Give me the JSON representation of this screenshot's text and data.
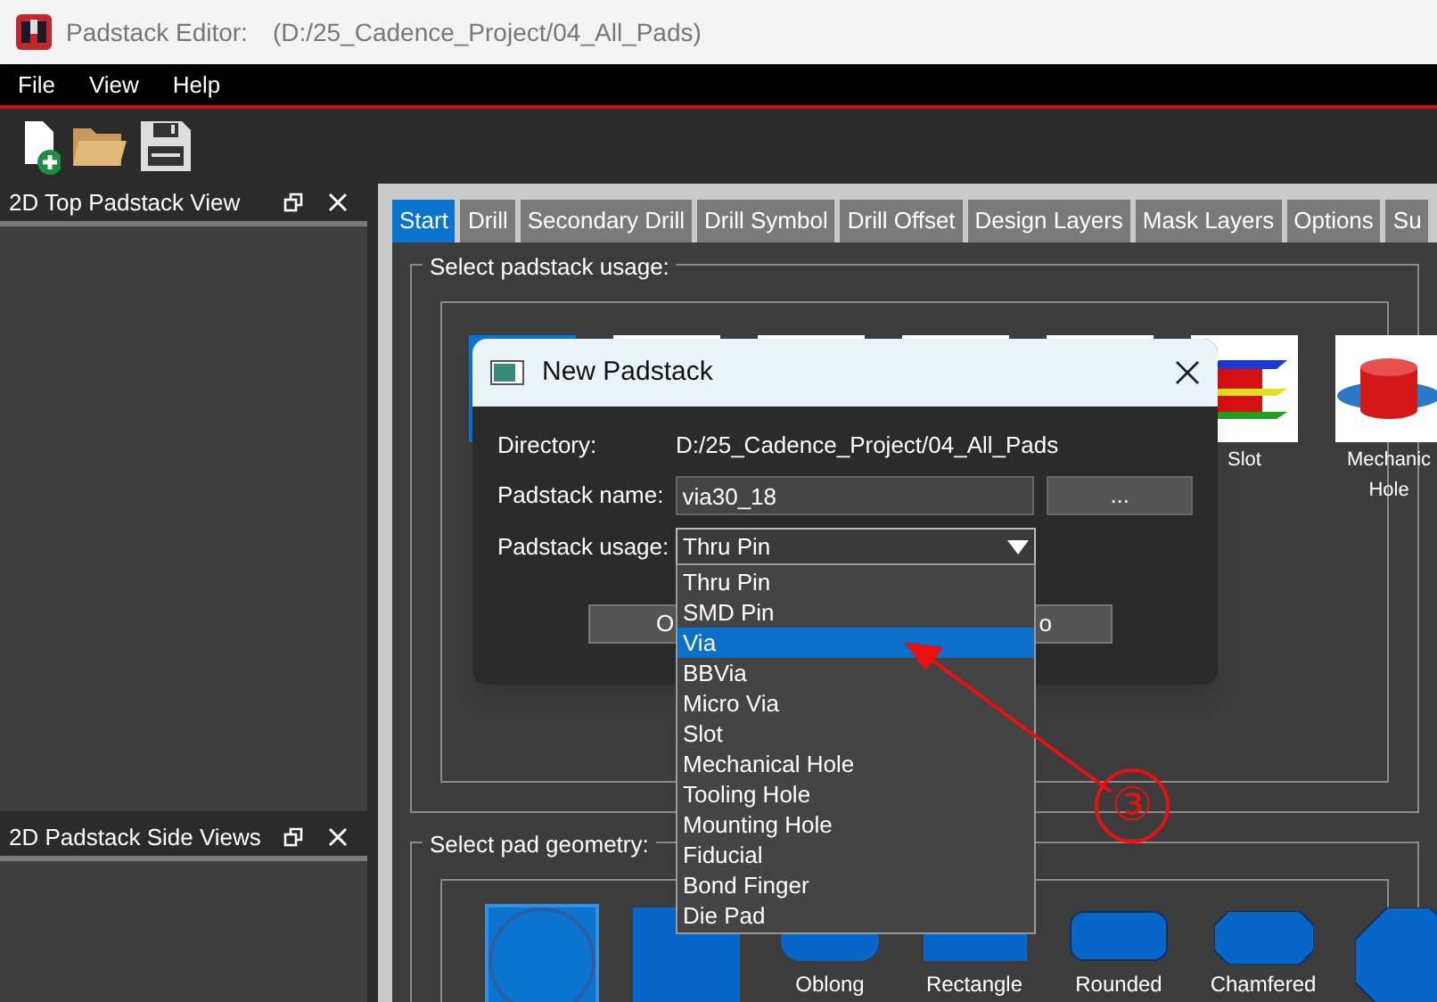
{
  "window": {
    "title": "Padstack Editor:",
    "path": "(D:/25_Cadence_Project/04_All_Pads)"
  },
  "menu": [
    "File",
    "View",
    "Help"
  ],
  "panels": [
    {
      "title": "2D Top Padstack View"
    },
    {
      "title": "2D Padstack Side Views"
    }
  ],
  "tabs": [
    {
      "label": "Start",
      "selected": true
    },
    {
      "label": "Drill",
      "selected": false
    },
    {
      "label": "Secondary Drill",
      "selected": false
    },
    {
      "label": "Drill Symbol",
      "selected": false
    },
    {
      "label": "Drill Offset",
      "selected": false
    },
    {
      "label": "Design Layers",
      "selected": false
    },
    {
      "label": "Mask Layers",
      "selected": false
    },
    {
      "label": "Options",
      "selected": false
    },
    {
      "label": "Su",
      "selected": false
    }
  ],
  "usage_group": {
    "title": "Select padstack usage:",
    "items": [
      {
        "kind": "blank",
        "selected": true
      },
      {
        "kind": "blank",
        "selected": false
      },
      {
        "kind": "blank",
        "selected": false
      },
      {
        "kind": "blank",
        "selected": false
      },
      {
        "kind": "blank",
        "selected": false
      },
      {
        "kind": "slot",
        "label": "Slot",
        "selected": false
      },
      {
        "kind": "mechanical",
        "label": "Mechanic Hole",
        "selected": false
      }
    ]
  },
  "geometry_group": {
    "title": "Select pad geometry:",
    "items": [
      {
        "kind": "circle",
        "selected": true
      },
      {
        "kind": "square",
        "selected": false
      },
      {
        "kind": "oblong",
        "label": "Oblong",
        "selected": false
      },
      {
        "kind": "rectangle",
        "label": "Rectangle",
        "selected": false
      },
      {
        "kind": "rounded",
        "label": "Rounded",
        "selected": false
      },
      {
        "kind": "chamfered",
        "label": "Chamfered",
        "selected": false
      },
      {
        "kind": "octagon",
        "selected": false
      }
    ]
  },
  "dialog": {
    "title": "New Padstack",
    "directory_label": "Directory:",
    "directory": "D:/25_Cadence_Project/04_All_Pads",
    "name_label": "Padstack name:",
    "name": "via30_18",
    "browse": "...",
    "usage_label": "Padstack usage:",
    "usage": "Thru Pin",
    "buttons": [
      "O",
      "o"
    ],
    "options": [
      {
        "label": "Thru Pin",
        "selected": false
      },
      {
        "label": "SMD Pin",
        "selected": false
      },
      {
        "label": "Via",
        "selected": true
      },
      {
        "label": "BBVia",
        "selected": false
      },
      {
        "label": "Micro Via",
        "selected": false
      },
      {
        "label": "Slot",
        "selected": false
      },
      {
        "label": "Mechanical Hole",
        "selected": false
      },
      {
        "label": "Tooling Hole",
        "selected": false
      },
      {
        "label": "Mounting Hole",
        "selected": false
      },
      {
        "label": "Fiducial",
        "selected": false
      },
      {
        "label": "Bond Finger",
        "selected": false
      },
      {
        "label": "Die Pad",
        "selected": false
      }
    ]
  },
  "annotation": {
    "label": "③"
  }
}
